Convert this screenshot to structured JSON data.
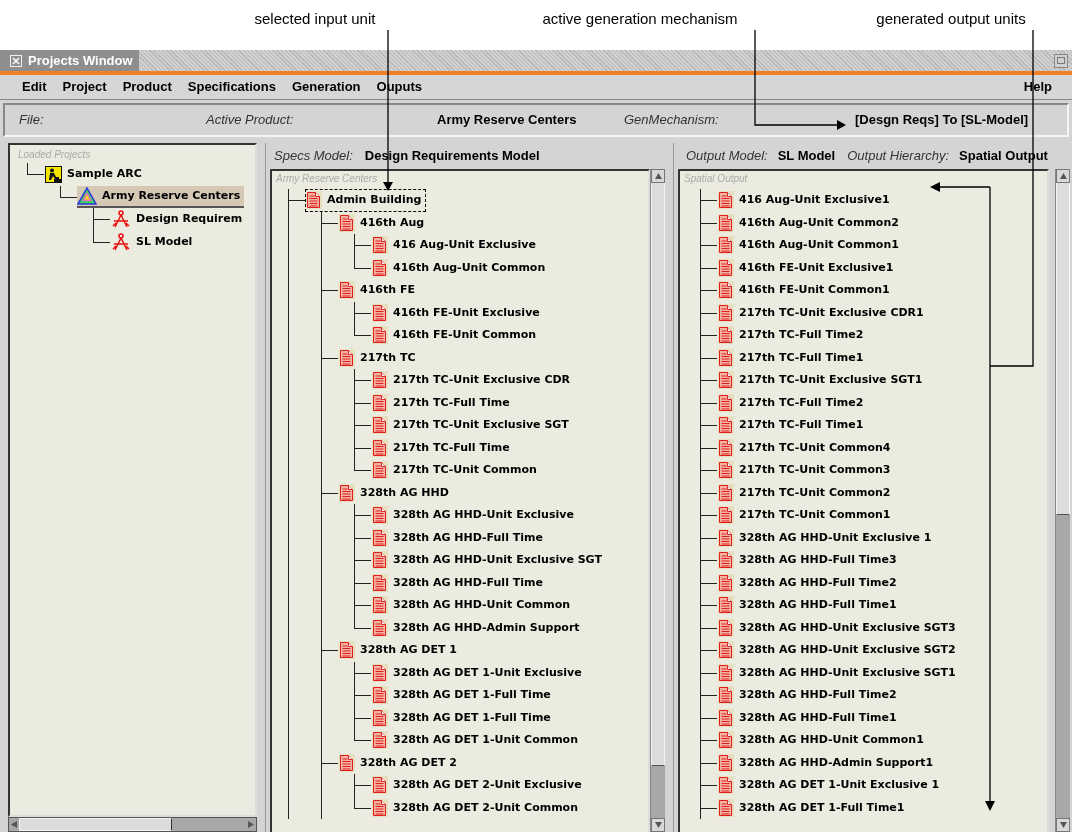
{
  "annotations": [
    {
      "text": "selected input unit"
    },
    {
      "text": "active generation mechanism"
    },
    {
      "text": "generated output units"
    }
  ],
  "window": {
    "title": "Projects Window"
  },
  "menu": [
    {
      "label": "Edit"
    },
    {
      "label": "Project"
    },
    {
      "label": "Product"
    },
    {
      "label": "Specifications"
    },
    {
      "label": "Generation"
    },
    {
      "label": "Ouputs"
    }
  ],
  "help_menu": "Help",
  "info_bar": {
    "file_label": "File:",
    "product_label": "Active Product:",
    "product": "Army Reserve Centers",
    "mechanism_label": "GenMechanism:",
    "mechanism": "[Desgn Reqs] To [SL-Model]"
  },
  "loaded_projects": {
    "title": "Loaded Projects",
    "tree": [
      {
        "label": "Sample ARC",
        "kind": "project",
        "selected": false,
        "children": [
          {
            "label": "Army Reserve Centers",
            "kind": "product",
            "selected": true,
            "children": [
              {
                "label": "Design Requirem",
                "kind": "model",
                "selected": false
              },
              {
                "label": "SL Model",
                "kind": "model",
                "selected": false
              }
            ]
          }
        ]
      }
    ]
  },
  "specs": {
    "label": "Specs Model:",
    "value": "Design Requirements Model",
    "tree_title": "Army Reserve Centers",
    "tree": [
      {
        "label": "Admin Building",
        "kind": "unit",
        "selected": true,
        "children": [
          {
            "label": "416th Aug",
            "kind": "unit",
            "selected": false,
            "children": [
              {
                "label": "416 Aug-Unit Exclusive",
                "kind": "unit",
                "selected": false
              },
              {
                "label": "416th Aug-Unit Common",
                "kind": "unit",
                "selected": false
              }
            ]
          },
          {
            "label": "416th FE",
            "kind": "unit",
            "selected": false,
            "children": [
              {
                "label": "416th FE-Unit Exclusive",
                "kind": "unit",
                "selected": false
              },
              {
                "label": "416th FE-Unit Common",
                "kind": "unit",
                "selected": false
              }
            ]
          },
          {
            "label": "217th TC",
            "kind": "unit",
            "selected": false,
            "children": [
              {
                "label": "217th TC-Unit Exclusive CDR",
                "kind": "unit",
                "selected": false
              },
              {
                "label": "217th TC-Full Time",
                "kind": "unit",
                "selected": false
              },
              {
                "label": "217th TC-Unit Exclusive SGT",
                "kind": "unit",
                "selected": false
              },
              {
                "label": "217th TC-Full Time",
                "kind": "unit",
                "selected": false
              },
              {
                "label": "217th TC-Unit Common",
                "kind": "unit",
                "selected": false
              }
            ]
          },
          {
            "label": "328th AG HHD",
            "kind": "unit",
            "selected": false,
            "children": [
              {
                "label": "328th AG HHD-Unit Exclusive",
                "kind": "unit",
                "selected": false
              },
              {
                "label": "328th AG HHD-Full Time",
                "kind": "unit",
                "selected": false
              },
              {
                "label": "328th AG HHD-Unit Exclusive SGT",
                "kind": "unit",
                "selected": false
              },
              {
                "label": "328th AG HHD-Full Time",
                "kind": "unit",
                "selected": false
              },
              {
                "label": "328th AG HHD-Unit Common",
                "kind": "unit",
                "selected": false
              },
              {
                "label": "328th AG HHD-Admin Support",
                "kind": "unit",
                "selected": false
              }
            ]
          },
          {
            "label": "328th AG DET 1",
            "kind": "unit",
            "selected": false,
            "children": [
              {
                "label": "328th AG DET 1-Unit Exclusive",
                "kind": "unit",
                "selected": false
              },
              {
                "label": "328th AG DET 1-Full Time",
                "kind": "unit",
                "selected": false
              },
              {
                "label": "328th AG DET 1-Full Time",
                "kind": "unit",
                "selected": false
              },
              {
                "label": "328th AG DET 1-Unit Common",
                "kind": "unit",
                "selected": false
              }
            ]
          },
          {
            "label": "328th AG DET 2",
            "kind": "unit",
            "selected": false,
            "children": [
              {
                "label": "328th AG DET 2-Unit Exclusive",
                "kind": "unit",
                "selected": false
              },
              {
                "label": "328th AG DET 2-Unit Common",
                "kind": "unit",
                "selected": false
              }
            ]
          }
        ]
      }
    ]
  },
  "output": {
    "model_label": "Output Model:",
    "model": "SL Model",
    "hierarchy_label": "Output Hierarchy:",
    "hierarchy": "Spatial Output",
    "tree_title": "Spatial Output",
    "items": [
      {
        "label": "416 Aug-Unit Exclusive1",
        "kind": "unit"
      },
      {
        "label": "416th Aug-Unit Common2",
        "kind": "unit"
      },
      {
        "label": "416th Aug-Unit Common1",
        "kind": "unit"
      },
      {
        "label": "416th FE-Unit Exclusive1",
        "kind": "unit"
      },
      {
        "label": "416th FE-Unit Common1",
        "kind": "unit"
      },
      {
        "label": "217th TC-Unit Exclusive CDR1",
        "kind": "unit"
      },
      {
        "label": "217th TC-Full Time2",
        "kind": "unit"
      },
      {
        "label": "217th TC-Full Time1",
        "kind": "unit"
      },
      {
        "label": "217th TC-Unit Exclusive SGT1",
        "kind": "unit"
      },
      {
        "label": "217th TC-Full Time2",
        "kind": "unit"
      },
      {
        "label": "217th TC-Full Time1",
        "kind": "unit"
      },
      {
        "label": "217th TC-Unit Common4",
        "kind": "unit"
      },
      {
        "label": "217th TC-Unit Common3",
        "kind": "unit"
      },
      {
        "label": "217th TC-Unit Common2",
        "kind": "unit"
      },
      {
        "label": "217th TC-Unit Common1",
        "kind": "unit"
      },
      {
        "label": "328th AG HHD-Unit Exclusive 1",
        "kind": "unit"
      },
      {
        "label": "328th AG HHD-Full Time3",
        "kind": "unit"
      },
      {
        "label": "328th AG HHD-Full Time2",
        "kind": "unit"
      },
      {
        "label": "328th AG HHD-Full Time1",
        "kind": "unit"
      },
      {
        "label": "328th AG HHD-Unit Exclusive SGT3",
        "kind": "unit"
      },
      {
        "label": "328th AG HHD-Unit Exclusive SGT2",
        "kind": "unit"
      },
      {
        "label": "328th AG HHD-Unit Exclusive SGT1",
        "kind": "unit"
      },
      {
        "label": "328th AG HHD-Full Time2",
        "kind": "unit"
      },
      {
        "label": "328th AG HHD-Full Time1",
        "kind": "unit"
      },
      {
        "label": "328th AG HHD-Unit Common1",
        "kind": "unit"
      },
      {
        "label": "328th AG HHD-Admin Support1",
        "kind": "unit"
      },
      {
        "label": "328th AG DET 1-Unit Exclusive 1",
        "kind": "unit"
      },
      {
        "label": "328th AG DET 1-Full Time1",
        "kind": "unit"
      }
    ]
  }
}
